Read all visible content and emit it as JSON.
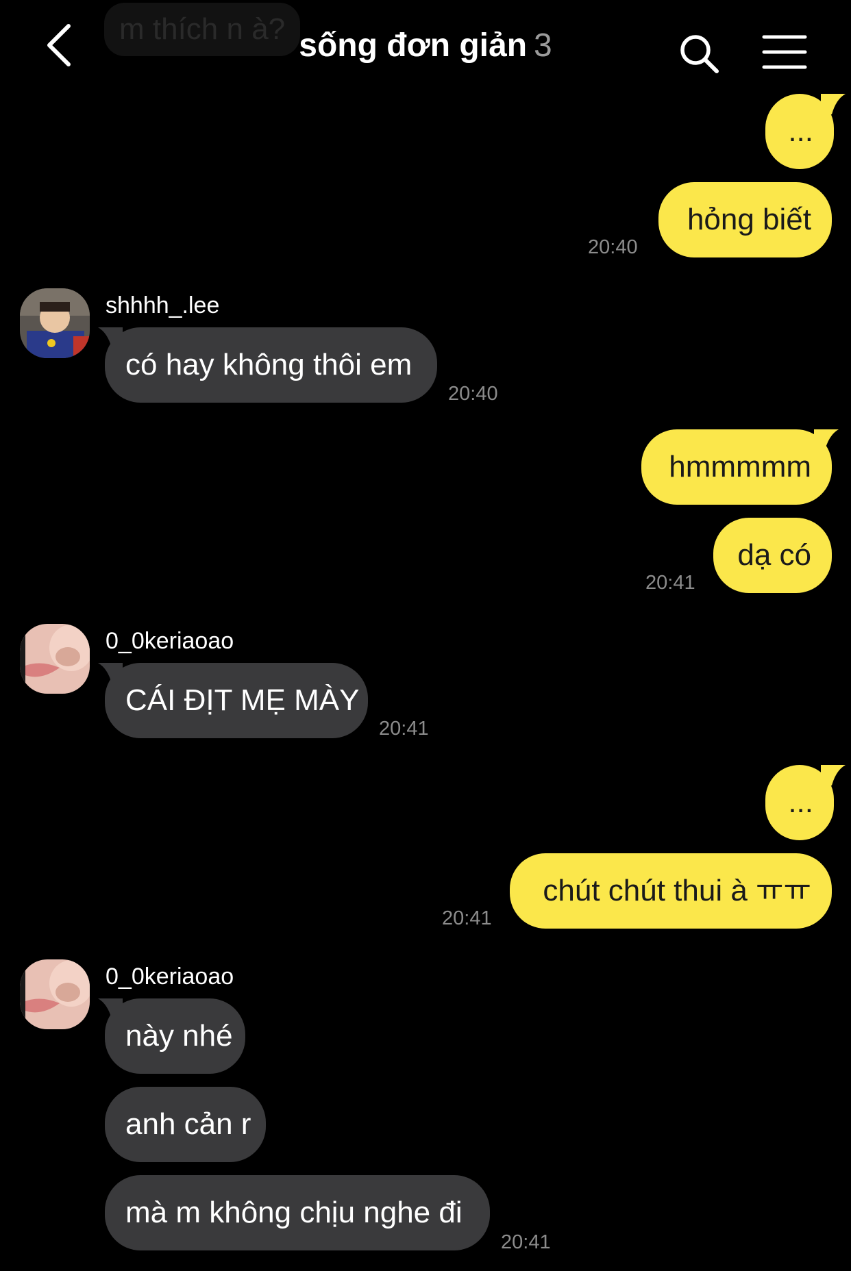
{
  "header": {
    "title": "sống đơn giản",
    "member_count": "3",
    "ghost_text": "m thích n à?",
    "back_icon": "chevron-left-icon",
    "search_icon": "search-icon",
    "menu_icon": "hamburger-menu-icon"
  },
  "colors": {
    "outgoing_bubble": "#fbe74b",
    "incoming_bubble": "#3a3a3c",
    "background": "#000000",
    "timestamp": "#8c8c8c"
  },
  "messages": [
    {
      "dir": "out",
      "text": "..."
    },
    {
      "dir": "out",
      "text": "hỏng biết",
      "time": "20:40"
    },
    {
      "dir": "in",
      "sender": "shhhh_.lee",
      "text": "có hay không thôi em",
      "time": "20:40"
    },
    {
      "dir": "out",
      "text": "hmmmmm"
    },
    {
      "dir": "out",
      "text": "dạ có",
      "time": "20:41"
    },
    {
      "dir": "in",
      "sender": "0_0keriaoao",
      "text": "CÁI ĐỊT MẸ MÀY",
      "time": "20:41"
    },
    {
      "dir": "out",
      "text": "..."
    },
    {
      "dir": "out",
      "text": "chút chút thui à ㅠㅠ",
      "time": "20:41"
    },
    {
      "dir": "in",
      "sender": "0_0keriaoao",
      "text": "này nhé"
    },
    {
      "dir": "in",
      "text": "anh cản r"
    },
    {
      "dir": "in",
      "text": "mà m không chịu nghe đi",
      "time": "20:41"
    }
  ]
}
